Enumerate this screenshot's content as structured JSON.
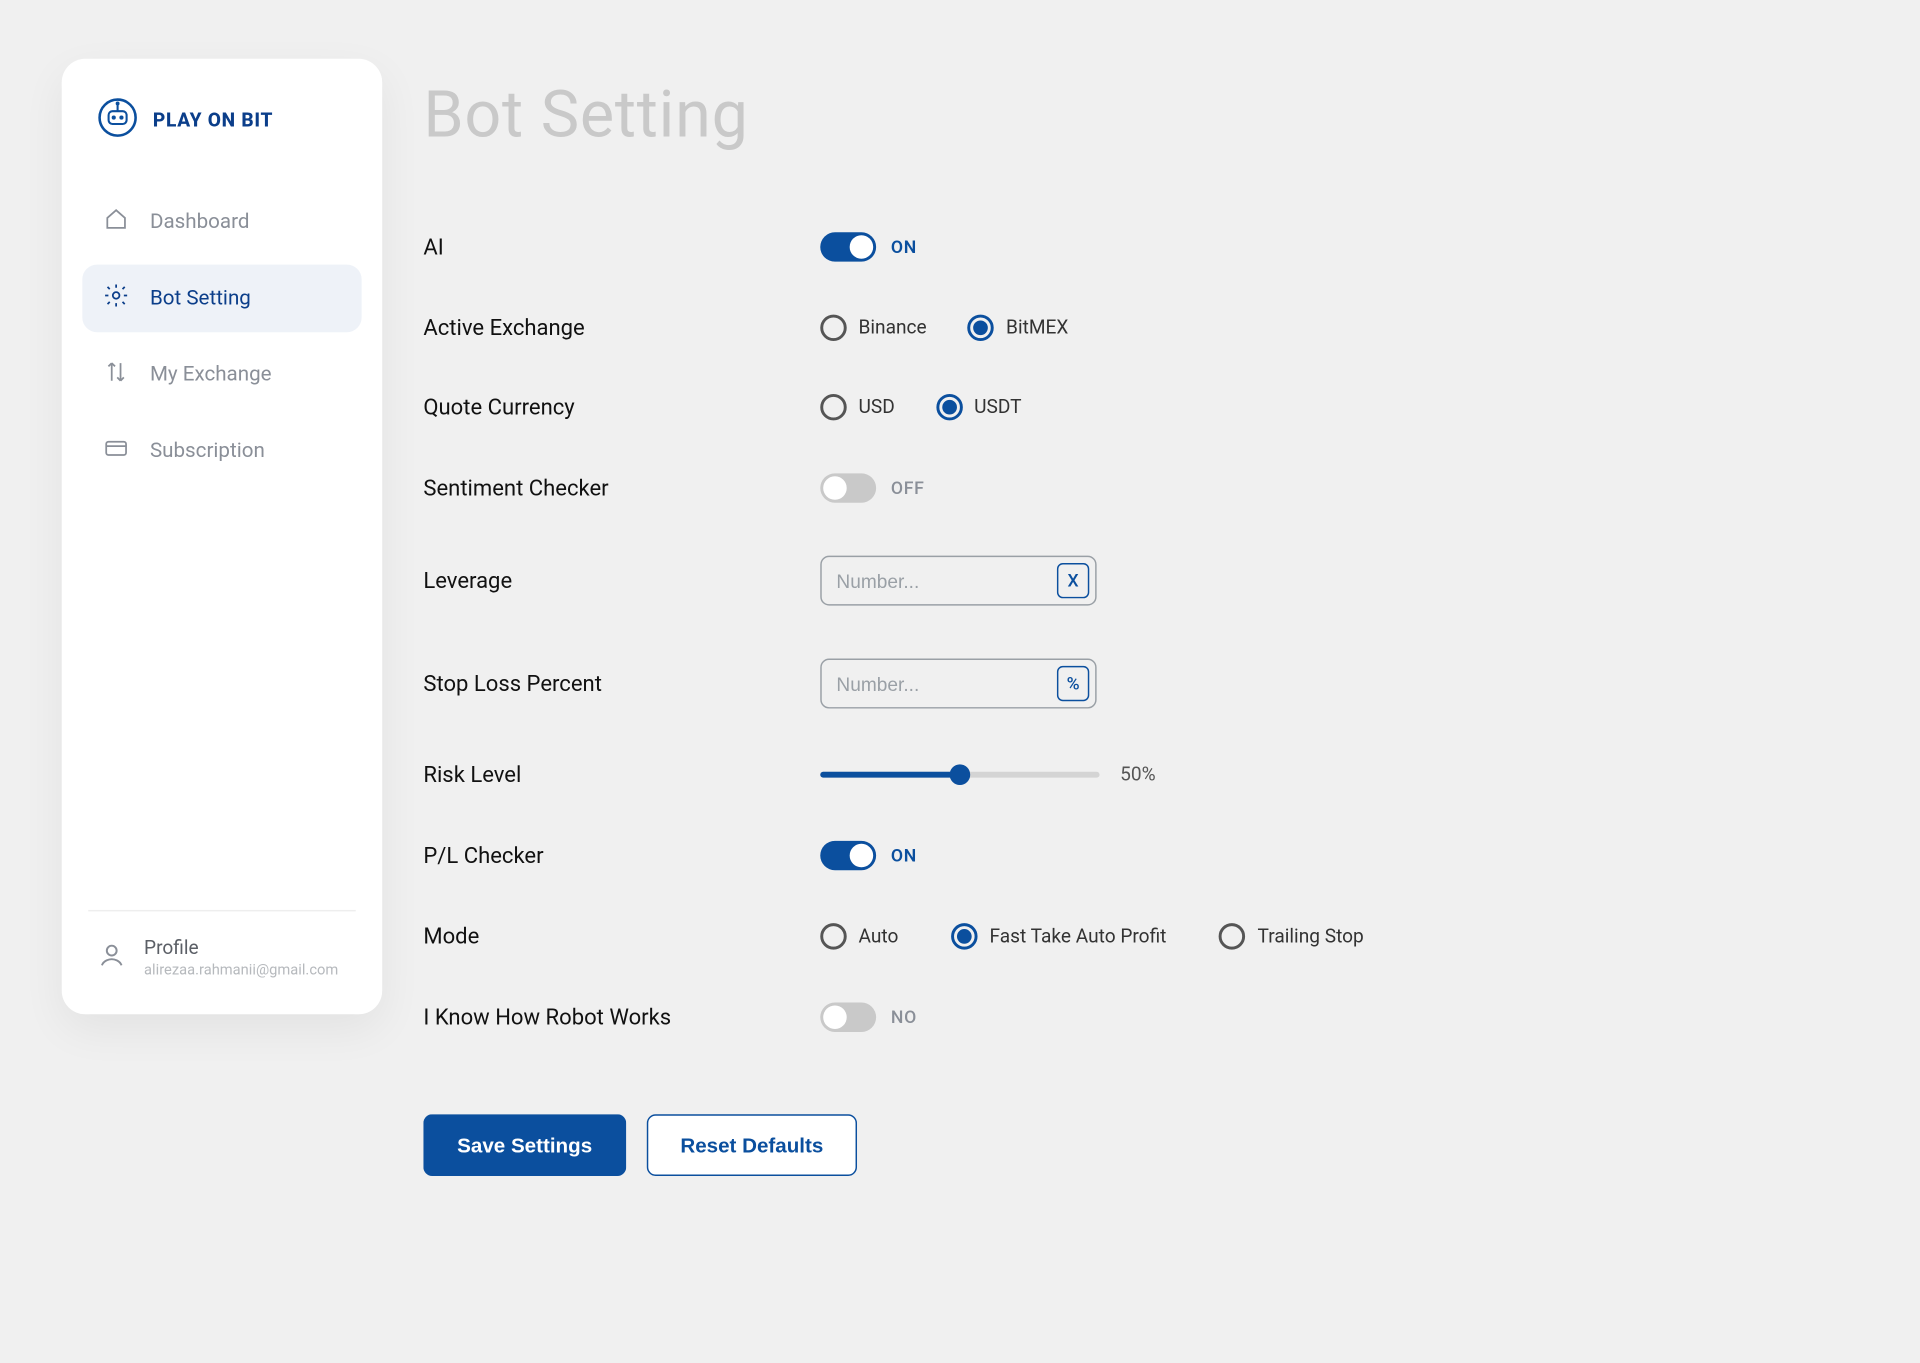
{
  "brand": {
    "name": "PLAY ON BIT"
  },
  "sidebar": {
    "items": [
      {
        "label": "Dashboard",
        "active": false
      },
      {
        "label": "Bot Setting",
        "active": true
      },
      {
        "label": "My Exchange",
        "active": false
      },
      {
        "label": "Subscription",
        "active": false
      }
    ],
    "profile": {
      "title": "Profile",
      "email": "alirezaa.rahmanii@gmail.com"
    }
  },
  "page": {
    "title": "Bot Setting"
  },
  "settings": {
    "ai": {
      "label": "AI",
      "state_label": "ON"
    },
    "active_exchange": {
      "label": "Active Exchange",
      "options": [
        "Binance",
        "BitMEX"
      ],
      "selected": "BitMEX"
    },
    "quote_currency": {
      "label": "Quote Currency",
      "options": [
        "USD",
        "USDT"
      ],
      "selected": "USDT"
    },
    "sentiment": {
      "label": "Sentiment Checker",
      "state_label": "OFF"
    },
    "leverage": {
      "label": "Leverage",
      "placeholder": "Number...",
      "suffix": "X"
    },
    "stoploss": {
      "label": "Stop Loss Percent",
      "placeholder": "Number...",
      "suffix": "%"
    },
    "risk": {
      "label": "Risk Level",
      "value_label": "50%",
      "percent": 50
    },
    "pl_checker": {
      "label": "P/L Checker",
      "state_label": "ON"
    },
    "mode": {
      "label": "Mode",
      "options": [
        "Auto",
        "Fast Take Auto Profit",
        "Trailing Stop"
      ],
      "selected": "Fast Take Auto Profit"
    },
    "know_robot": {
      "label": "I Know How Robot Works",
      "state_label": "NO"
    }
  },
  "actions": {
    "save": "Save Settings",
    "reset": "Reset Defaults"
  }
}
